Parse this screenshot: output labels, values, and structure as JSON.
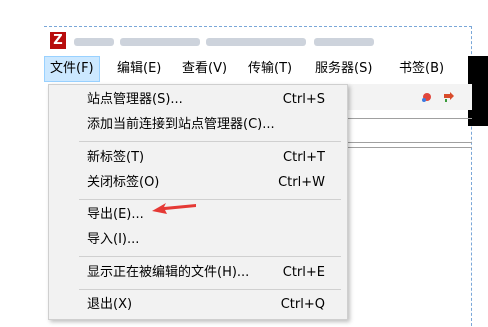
{
  "menubar": {
    "items": [
      {
        "label": "文件(F)"
      },
      {
        "label": "编辑(E)"
      },
      {
        "label": "查看(V)"
      },
      {
        "label": "传输(T)"
      },
      {
        "label": "服务器(S)"
      },
      {
        "label": "书签(B)"
      }
    ]
  },
  "file_menu": {
    "items": [
      {
        "label": "站点管理器(S)...",
        "shortcut": "Ctrl+S"
      },
      {
        "label": "添加当前连接到站点管理器(C)...",
        "shortcut": ""
      },
      {
        "label": "新标签(T)",
        "shortcut": "Ctrl+T"
      },
      {
        "label": "关闭标签(O)",
        "shortcut": "Ctrl+W"
      },
      {
        "label": "导出(E)...",
        "shortcut": ""
      },
      {
        "label": "导入(I)...",
        "shortcut": ""
      },
      {
        "label": "显示正在被编辑的文件(H)...",
        "shortcut": "Ctrl+E"
      },
      {
        "label": "退出(X)",
        "shortcut": "Ctrl+Q"
      }
    ]
  },
  "colors": {
    "menu_bg": "#f2f2f2",
    "active_menubar_bg": "#cce8ff",
    "arrow": "#e53935",
    "app_icon": "#b80c0c"
  },
  "icons": [
    "filezilla-app-icon",
    "red-arrow-annotation"
  ]
}
